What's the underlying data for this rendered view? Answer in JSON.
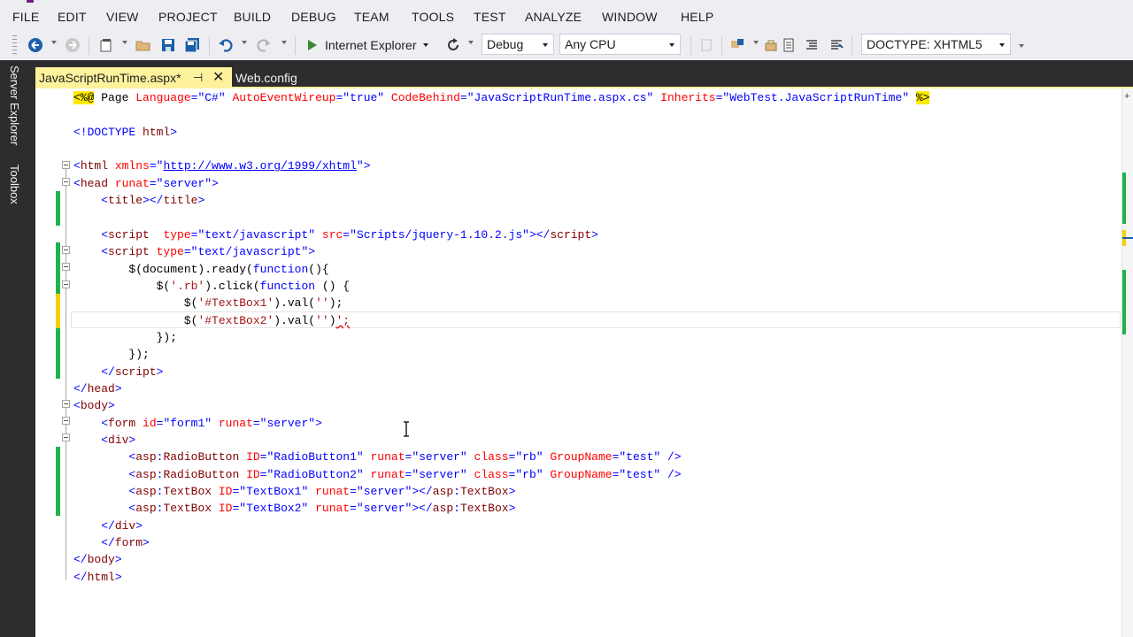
{
  "menu": {
    "items": [
      {
        "label": "FILE",
        "name": "menu-file"
      },
      {
        "label": "EDIT",
        "name": "menu-edit"
      },
      {
        "label": "VIEW",
        "name": "menu-view"
      },
      {
        "label": "PROJECT",
        "name": "menu-project"
      },
      {
        "label": "BUILD",
        "name": "menu-build"
      },
      {
        "label": "DEBUG",
        "name": "menu-debug"
      },
      {
        "label": "TEAM",
        "name": "menu-team"
      },
      {
        "label": "TOOLS",
        "name": "menu-tools"
      },
      {
        "label": "TEST",
        "name": "menu-test"
      },
      {
        "label": "ANALYZE",
        "name": "menu-analyze"
      },
      {
        "label": "WINDOW",
        "name": "menu-window"
      },
      {
        "label": "HELP",
        "name": "menu-help"
      }
    ]
  },
  "toolbar": {
    "run_target": "Internet Explorer",
    "configuration": "Debug",
    "platform": "Any CPU",
    "doctype": "DOCTYPE: XHTML5",
    "icons": [
      "back-icon",
      "forward-icon",
      "new-project-icon",
      "open-file-icon",
      "save-icon",
      "save-all-icon",
      "undo-icon",
      "redo-icon",
      "start-icon",
      "refresh-icon",
      "find-icon",
      "format-icon"
    ]
  },
  "side_panels": {
    "server_explorer": "Server Explorer",
    "toolbox": "Toolbox"
  },
  "tabs": {
    "active": "JavaScriptRunTime.aspx*",
    "active_pin": "⊣",
    "active_close": "✕",
    "inactive": "Web.config"
  },
  "colors": {
    "ide_dark": "#2d2d30",
    "tab_active": "#fff29d",
    "tag": "#800000",
    "attribute": "#ff0000",
    "value": "#0000ff",
    "string": "#a31515",
    "change_saved": "#22b14c",
    "change_unsaved": "#f5d000"
  },
  "code": {
    "lines": [
      [
        [
          "<%@",
          "hl"
        ],
        [
          " Page ",
          "m"
        ],
        [
          "Language",
          "a"
        ],
        [
          "=\"C#\" ",
          "v"
        ],
        [
          "AutoEventWireup",
          "a"
        ],
        [
          "=\"true\" ",
          "v"
        ],
        [
          "CodeBehind",
          "a"
        ],
        [
          "=\"JavaScriptRunTime.aspx.cs\" ",
          "v"
        ],
        [
          "Inherits",
          "a"
        ],
        [
          "=\"WebTest.JavaScriptRunTime\" ",
          "v"
        ],
        [
          "%>",
          "hl"
        ]
      ],
      [],
      [
        [
          "<!DOCTYPE ",
          "b"
        ],
        [
          "html",
          "t"
        ],
        [
          ">",
          "b"
        ]
      ],
      [],
      [
        [
          "<",
          "b"
        ],
        [
          "html ",
          "t"
        ],
        [
          "xmlns",
          "a"
        ],
        [
          "=\"",
          "v"
        ],
        [
          "http://www.w3.org/1999/xhtml",
          "u"
        ],
        [
          "\"",
          "v"
        ],
        [
          ">",
          "b"
        ]
      ],
      [
        [
          "<",
          "b"
        ],
        [
          "head ",
          "t"
        ],
        [
          "runat",
          "a"
        ],
        [
          "=\"server\"",
          "v"
        ],
        [
          ">",
          "b"
        ]
      ],
      [
        [
          "    <",
          "b"
        ],
        [
          "title",
          "t"
        ],
        [
          "></",
          "b"
        ],
        [
          "title",
          "t"
        ],
        [
          ">",
          "b"
        ]
      ],
      [],
      [
        [
          "    <",
          "b"
        ],
        [
          "script  ",
          "t"
        ],
        [
          "type",
          "a"
        ],
        [
          "=\"text/javascript\" ",
          "v"
        ],
        [
          "src",
          "a"
        ],
        [
          "=\"Scripts/jquery-1.10.2.js\"",
          "v"
        ],
        [
          "></",
          "b"
        ],
        [
          "script",
          "t"
        ],
        [
          ">",
          "b"
        ]
      ],
      [
        [
          "    <",
          "b"
        ],
        [
          "script ",
          "t"
        ],
        [
          "type",
          "a"
        ],
        [
          "=\"text/javascript\"",
          "v"
        ],
        [
          ">",
          "b"
        ]
      ],
      [
        [
          "        $(document).ready(",
          "k"
        ],
        [
          "function",
          "kw"
        ],
        [
          "(){",
          "k"
        ]
      ],
      [
        [
          "            $(",
          "k"
        ],
        [
          "'.rb'",
          "s"
        ],
        [
          ").click(",
          "k"
        ],
        [
          "function",
          "kw"
        ],
        [
          " () {",
          "k"
        ]
      ],
      [
        [
          "                $(",
          "k"
        ],
        [
          "'#TextBox1'",
          "s"
        ],
        [
          ").val(",
          "k"
        ],
        [
          "''",
          "s"
        ],
        [
          ");",
          "k"
        ]
      ],
      [
        [
          "                $(",
          "k"
        ],
        [
          "'#TextBox2'",
          "s"
        ],
        [
          ").val(",
          "k"
        ],
        [
          "''",
          "s"
        ],
        [
          ")",
          "k"
        ],
        [
          "';",
          "err"
        ]
      ],
      [
        [
          "            });",
          "k"
        ]
      ],
      [
        [
          "        });",
          "k"
        ]
      ],
      [
        [
          "    </",
          "b"
        ],
        [
          "script",
          "t"
        ],
        [
          ">",
          "b"
        ]
      ],
      [
        [
          "</",
          "b"
        ],
        [
          "head",
          "t"
        ],
        [
          ">",
          "b"
        ]
      ],
      [
        [
          "<",
          "b"
        ],
        [
          "body",
          "t"
        ],
        [
          ">",
          "b"
        ]
      ],
      [
        [
          "    <",
          "b"
        ],
        [
          "form ",
          "t"
        ],
        [
          "id",
          "a"
        ],
        [
          "=\"form1\" ",
          "v"
        ],
        [
          "runat",
          "a"
        ],
        [
          "=\"server\"",
          "v"
        ],
        [
          ">",
          "b"
        ]
      ],
      [
        [
          "    <",
          "b"
        ],
        [
          "div",
          "t"
        ],
        [
          ">",
          "b"
        ]
      ],
      [
        [
          "        <",
          "b"
        ],
        [
          "asp",
          "t"
        ],
        [
          ":",
          "b"
        ],
        [
          "RadioButton ",
          "t"
        ],
        [
          "ID",
          "a"
        ],
        [
          "=\"RadioButton1\" ",
          "v"
        ],
        [
          "runat",
          "a"
        ],
        [
          "=\"server\" ",
          "v"
        ],
        [
          "class",
          "a"
        ],
        [
          "=\"rb\" ",
          "v"
        ],
        [
          "GroupName",
          "a"
        ],
        [
          "=\"test\" ",
          "v"
        ],
        [
          "/>",
          "b"
        ]
      ],
      [
        [
          "        <",
          "b"
        ],
        [
          "asp",
          "t"
        ],
        [
          ":",
          "b"
        ],
        [
          "RadioButton ",
          "t"
        ],
        [
          "ID",
          "a"
        ],
        [
          "=\"RadioButton2\" ",
          "v"
        ],
        [
          "runat",
          "a"
        ],
        [
          "=\"server\" ",
          "v"
        ],
        [
          "class",
          "a"
        ],
        [
          "=\"rb\" ",
          "v"
        ],
        [
          "GroupName",
          "a"
        ],
        [
          "=\"test\" ",
          "v"
        ],
        [
          "/>",
          "b"
        ]
      ],
      [
        [
          "        <",
          "b"
        ],
        [
          "asp",
          "t"
        ],
        [
          ":",
          "b"
        ],
        [
          "TextBox ",
          "t"
        ],
        [
          "ID",
          "a"
        ],
        [
          "=\"TextBox1\" ",
          "v"
        ],
        [
          "runat",
          "a"
        ],
        [
          "=\"server\"",
          "v"
        ],
        [
          "></",
          "b"
        ],
        [
          "asp",
          "t"
        ],
        [
          ":",
          "b"
        ],
        [
          "TextBox",
          "t"
        ],
        [
          ">",
          "b"
        ]
      ],
      [
        [
          "        <",
          "b"
        ],
        [
          "asp",
          "t"
        ],
        [
          ":",
          "b"
        ],
        [
          "TextBox ",
          "t"
        ],
        [
          "ID",
          "a"
        ],
        [
          "=\"TextBox2\" ",
          "v"
        ],
        [
          "runat",
          "a"
        ],
        [
          "=\"server\"",
          "v"
        ],
        [
          "></",
          "b"
        ],
        [
          "asp",
          "t"
        ],
        [
          ":",
          "b"
        ],
        [
          "TextBox",
          "t"
        ],
        [
          ">",
          "b"
        ]
      ],
      [
        [
          "    </",
          "b"
        ],
        [
          "div",
          "t"
        ],
        [
          ">",
          "b"
        ]
      ],
      [
        [
          "    </",
          "b"
        ],
        [
          "form",
          "t"
        ],
        [
          ">",
          "b"
        ]
      ],
      [
        [
          "</",
          "b"
        ],
        [
          "body",
          "t"
        ],
        [
          ">",
          "b"
        ]
      ],
      [
        [
          "</",
          "b"
        ],
        [
          "html",
          "t"
        ],
        [
          ">",
          "b"
        ]
      ]
    ]
  }
}
